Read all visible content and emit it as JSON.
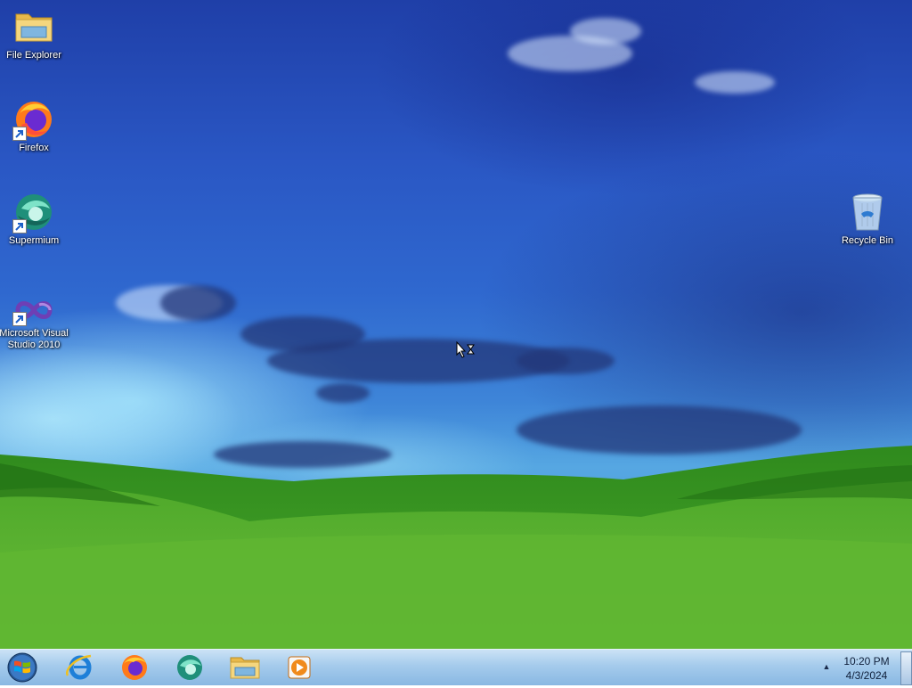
{
  "desktop": {
    "icons": [
      {
        "label": "File Explorer",
        "icon": "folder-icon",
        "shortcut": false
      },
      {
        "label": "Firefox",
        "icon": "firefox-icon",
        "shortcut": true
      },
      {
        "label": "Supermium",
        "icon": "supermium-icon",
        "shortcut": true
      },
      {
        "label": "Microsoft Visual Studio 2010",
        "icon": "visual-studio-icon",
        "shortcut": true
      },
      {
        "label": "Recycle Bin",
        "icon": "recycle-bin-icon",
        "shortcut": false
      }
    ]
  },
  "taskbar": {
    "start_button": {
      "icon": "windows-logo-icon"
    },
    "pinned": [
      {
        "name": "Internet Explorer",
        "icon": "internet-explorer-icon"
      },
      {
        "name": "Firefox",
        "icon": "firefox-icon"
      },
      {
        "name": "Supermium",
        "icon": "supermium-icon"
      },
      {
        "name": "File Explorer",
        "icon": "folder-icon"
      },
      {
        "name": "Windows Media Player",
        "icon": "media-player-icon"
      }
    ],
    "tray": {
      "show_hidden_icon": "chevron-up-icon",
      "time": "10:20 PM",
      "date": "4/3/2024"
    }
  },
  "cursor": {
    "icon": "busy-cursor-icon"
  }
}
